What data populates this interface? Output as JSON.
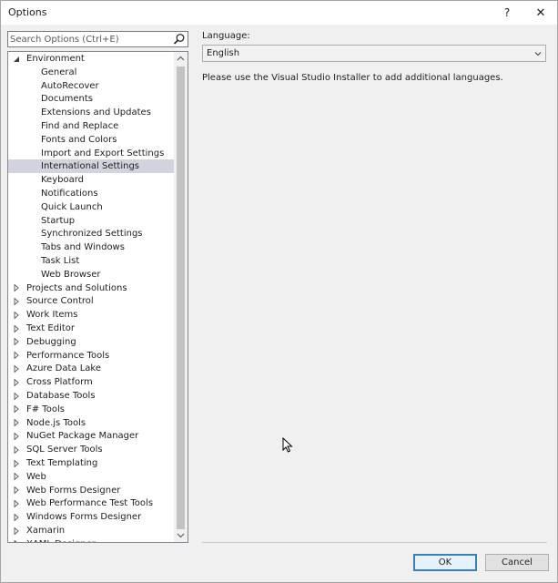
{
  "window": {
    "title": "Options",
    "help_glyph": "?",
    "close_glyph": "✕"
  },
  "search": {
    "placeholder": "Search Options (Ctrl+E)"
  },
  "tree": {
    "items": [
      {
        "label": "Environment",
        "level": 0,
        "expander": "expanded"
      },
      {
        "label": "General",
        "level": 1
      },
      {
        "label": "AutoRecover",
        "level": 1
      },
      {
        "label": "Documents",
        "level": 1
      },
      {
        "label": "Extensions and Updates",
        "level": 1
      },
      {
        "label": "Find and Replace",
        "level": 1
      },
      {
        "label": "Fonts and Colors",
        "level": 1
      },
      {
        "label": "Import and Export Settings",
        "level": 1
      },
      {
        "label": "International Settings",
        "level": 1,
        "selected": true
      },
      {
        "label": "Keyboard",
        "level": 1
      },
      {
        "label": "Notifications",
        "level": 1
      },
      {
        "label": "Quick Launch",
        "level": 1
      },
      {
        "label": "Startup",
        "level": 1
      },
      {
        "label": "Synchronized Settings",
        "level": 1
      },
      {
        "label": "Tabs and Windows",
        "level": 1
      },
      {
        "label": "Task List",
        "level": 1
      },
      {
        "label": "Web Browser",
        "level": 1
      },
      {
        "label": "Projects and Solutions",
        "level": 0,
        "expander": "collapsed"
      },
      {
        "label": "Source Control",
        "level": 0,
        "expander": "collapsed"
      },
      {
        "label": "Work Items",
        "level": 0,
        "expander": "collapsed"
      },
      {
        "label": "Text Editor",
        "level": 0,
        "expander": "collapsed"
      },
      {
        "label": "Debugging",
        "level": 0,
        "expander": "collapsed"
      },
      {
        "label": "Performance Tools",
        "level": 0,
        "expander": "collapsed"
      },
      {
        "label": "Azure Data Lake",
        "level": 0,
        "expander": "collapsed"
      },
      {
        "label": "Cross Platform",
        "level": 0,
        "expander": "collapsed"
      },
      {
        "label": "Database Tools",
        "level": 0,
        "expander": "collapsed"
      },
      {
        "label": "F# Tools",
        "level": 0,
        "expander": "collapsed"
      },
      {
        "label": "Node.js Tools",
        "level": 0,
        "expander": "collapsed"
      },
      {
        "label": "NuGet Package Manager",
        "level": 0,
        "expander": "collapsed"
      },
      {
        "label": "SQL Server Tools",
        "level": 0,
        "expander": "collapsed"
      },
      {
        "label": "Text Templating",
        "level": 0,
        "expander": "collapsed"
      },
      {
        "label": "Web",
        "level": 0,
        "expander": "collapsed"
      },
      {
        "label": "Web Forms Designer",
        "level": 0,
        "expander": "collapsed"
      },
      {
        "label": "Web Performance Test Tools",
        "level": 0,
        "expander": "collapsed"
      },
      {
        "label": "Windows Forms Designer",
        "level": 0,
        "expander": "collapsed"
      },
      {
        "label": "Xamarin",
        "level": 0,
        "expander": "collapsed"
      },
      {
        "label": "XAML Designer",
        "level": 0,
        "expander": "collapsed"
      }
    ]
  },
  "settings": {
    "language_label": "Language:",
    "language_value": "English",
    "info_text": "Please use the Visual Studio Installer to add additional languages."
  },
  "buttons": {
    "ok_label": "OK",
    "cancel_label": "Cancel"
  },
  "colors": {
    "selection": "#d3d3de",
    "ok_border": "#3c7fb1"
  }
}
